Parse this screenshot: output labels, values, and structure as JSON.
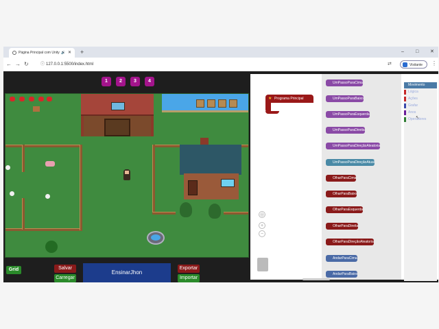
{
  "browser": {
    "tab_title": "Página Principal com Unity",
    "new_tab": "+",
    "url": "127.0.0.1:5500/index.html",
    "profile": "Visitante",
    "window_controls": [
      "–",
      "□",
      "✕"
    ]
  },
  "levels": [
    "1",
    "2",
    "3",
    "4"
  ],
  "controls": {
    "grid": "Grid",
    "salvar": "Salvar",
    "carregar": "Carregar",
    "exportar": "Exportar",
    "importar": "Importar",
    "name": "EnsinarJhon"
  },
  "workspace": {
    "program_block": "Programa Principal",
    "flyout": [
      {
        "label": "UmPassoParaCima",
        "color": "purple"
      },
      {
        "label": "UmPassoParaBaixo",
        "color": "purple"
      },
      {
        "label": "UmPassoParaEsquerda",
        "color": "purple"
      },
      {
        "label": "UmPassoParaDireita",
        "color": "purple"
      },
      {
        "label": "UmPassoParaDireçãoAleatoria",
        "color": "purple"
      },
      {
        "label": "UmPassoParaDireçãoAtual",
        "color": "teal"
      },
      {
        "label": "OlharParaCima",
        "color": "red"
      },
      {
        "label": "OlharParaBaixo",
        "color": "red"
      },
      {
        "label": "OlharParaEsquerda",
        "color": "red"
      },
      {
        "label": "OlharParaDireita",
        "color": "red"
      },
      {
        "label": "OlharParaDireçãoAleatoria",
        "color": "red"
      },
      {
        "label": "AndarParaCima",
        "color": "blue"
      },
      {
        "label": "AndarParaBaixo",
        "color": "blue"
      }
    ],
    "toolbox": [
      {
        "label": "Movimento",
        "color": "#c62828",
        "selected": true
      },
      {
        "label": "Lógica",
        "color": "#c62828"
      },
      {
        "label": "Ações",
        "color": "#c62828"
      },
      {
        "label": "Grafar",
        "color": "#3949ab"
      },
      {
        "label": "Anos",
        "color": "#6a1b9a"
      },
      {
        "label": "Operadores",
        "color": "#2e7d32"
      }
    ]
  }
}
